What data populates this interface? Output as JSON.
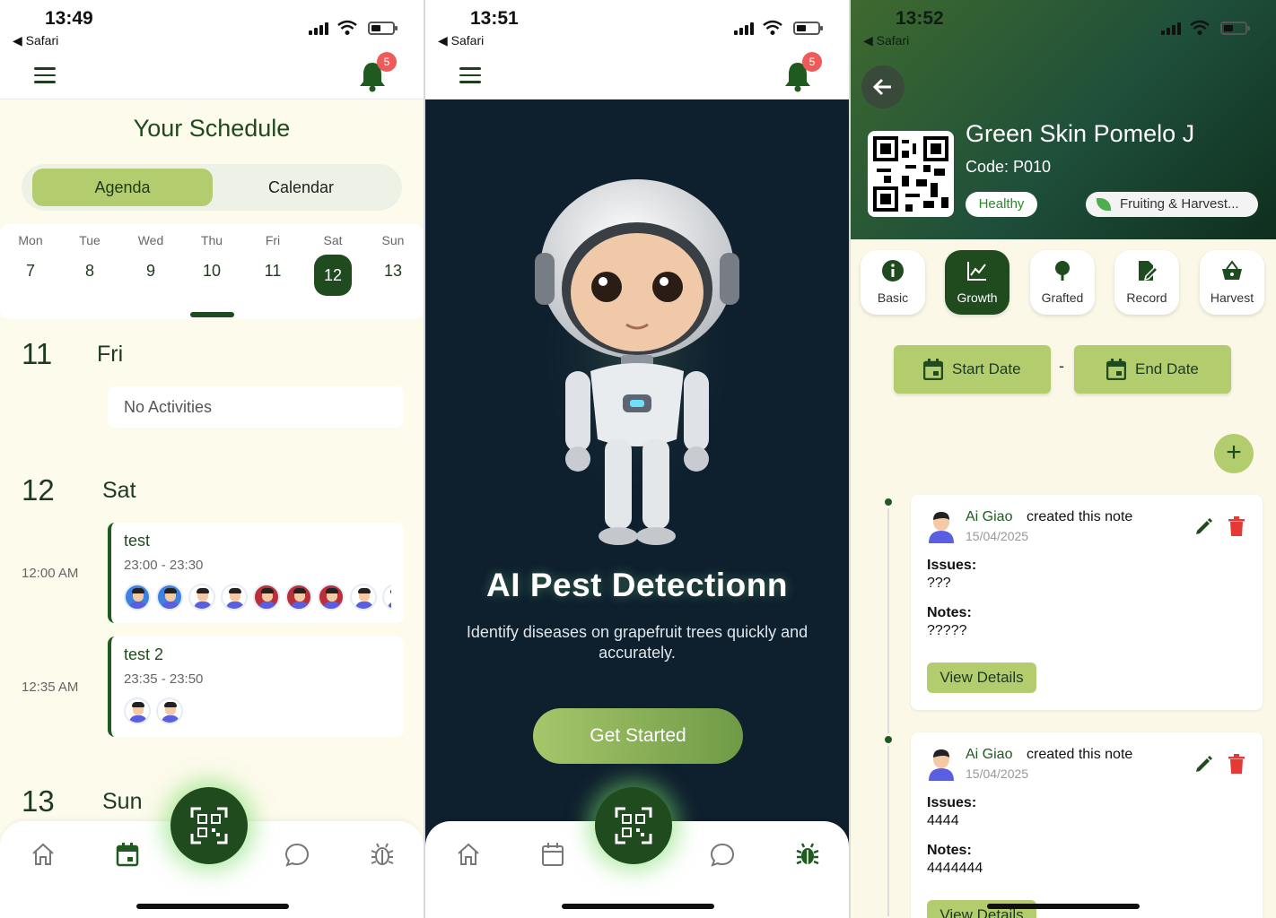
{
  "screen1": {
    "status": {
      "time": "13:49",
      "back_app": "◀ Safari"
    },
    "notif_count": "5",
    "title": "Your Schedule",
    "tabs": {
      "agenda": "Agenda",
      "calendar": "Calendar"
    },
    "week": [
      {
        "dn": "Mon",
        "dd": "7"
      },
      {
        "dn": "Tue",
        "dd": "8"
      },
      {
        "dn": "Wed",
        "dd": "9"
      },
      {
        "dn": "Thu",
        "dd": "10"
      },
      {
        "dn": "Fri",
        "dd": "11"
      },
      {
        "dn": "Sat",
        "dd": "12"
      },
      {
        "dn": "Sun",
        "dd": "13"
      }
    ],
    "selected_day": "12",
    "days": [
      {
        "num": "11",
        "name": "Fri",
        "empty": "No Activities"
      },
      {
        "num": "12",
        "name": "Sat"
      },
      {
        "num": "13",
        "name": "Sun"
      }
    ],
    "events": [
      {
        "time_label": "12:00 AM",
        "name": "test",
        "range": "23:00 - 23:30"
      },
      {
        "time_label": "12:35 AM",
        "name": "test 2",
        "range": "23:35 - 23:50"
      }
    ]
  },
  "screen2": {
    "status": {
      "time": "13:51",
      "back_app": "◀ Safari"
    },
    "notif_count": "5",
    "title": "AI Pest Detectionn",
    "subtitle": "Identify diseases on grapefruit trees quickly and accurately.",
    "cta": "Get Started"
  },
  "screen3": {
    "status": {
      "time": "13:52",
      "back_app": "◀ Safari"
    },
    "plant_name": "Green Skin Pomelo J",
    "code": "Code: P010",
    "health": "Healthy",
    "stage": "Fruiting & Harvest...",
    "tabs": [
      "Basic",
      "Growth",
      "Grafted",
      "Record",
      "Harvest"
    ],
    "active_tab": "Growth",
    "start_date": "Start Date",
    "end_date": "End Date",
    "dash": "-",
    "plus": "+",
    "notes": [
      {
        "author": "Ai Giao",
        "action": "created this note",
        "date": "15/04/2025",
        "issues_label": "Issues:",
        "issues": "???",
        "notes_label": "Notes:",
        "notes": "?????",
        "button": "View Details"
      },
      {
        "author": "Ai Giao",
        "action": "created this note",
        "date": "15/04/2025",
        "issues_label": "Issues:",
        "issues": "4444",
        "notes_label": "Notes:",
        "notes": "4444444",
        "button": "View Details"
      }
    ]
  },
  "colors": {
    "primary_dark": "#1f4b1f",
    "accent_green": "#b3cc6e",
    "badge_red": "#ef5b5b",
    "cream_bg": "#fdfbec",
    "navy_bg": "#0e1f2e"
  }
}
